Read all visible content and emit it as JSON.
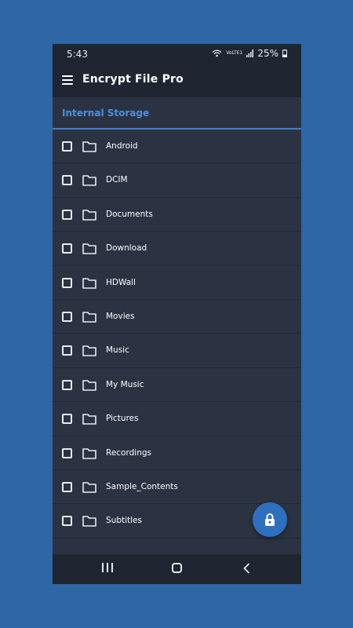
{
  "status": {
    "time": "5:43",
    "network_label": "VoLTE1",
    "battery": "25%"
  },
  "app": {
    "title": "Encrypt File Pro"
  },
  "breadcrumb": {
    "label": "Internal Storage"
  },
  "folders": [
    {
      "label": "Android"
    },
    {
      "label": "DCIM"
    },
    {
      "label": "Documents"
    },
    {
      "label": "Download"
    },
    {
      "label": "HDWall"
    },
    {
      "label": "Movies"
    },
    {
      "label": "Music"
    },
    {
      "label": "My Music"
    },
    {
      "label": "Pictures"
    },
    {
      "label": "Recordings"
    },
    {
      "label": "Sample_Contents"
    },
    {
      "label": "Subtitles"
    }
  ],
  "icons": {
    "menu": "hamburger-icon",
    "folder": "folder-icon",
    "checkbox": "checkbox-icon",
    "fab": "lock-icon",
    "wifi": "wifi-icon",
    "signal": "signal-icon",
    "battery": "battery-icon",
    "nav_recents": "recents-icon",
    "nav_home": "home-icon",
    "nav_back": "back-icon"
  },
  "colors": {
    "background": "#2e66a6",
    "surface": "#2b3342",
    "bar": "#1f2632",
    "accent": "#4a90e2",
    "fab": "#2f6fc0"
  }
}
